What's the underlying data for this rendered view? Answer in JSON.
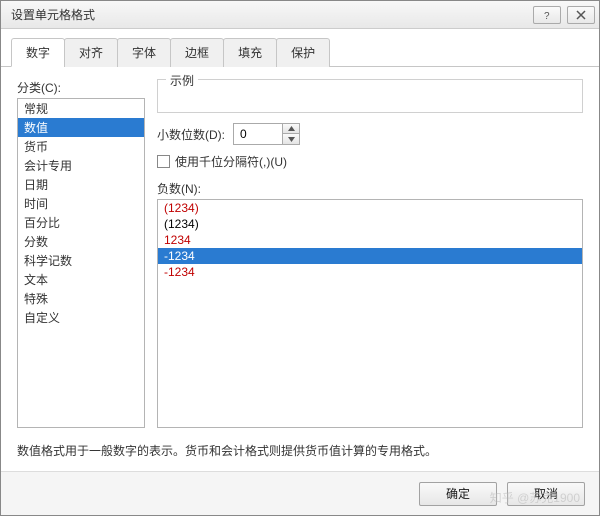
{
  "window": {
    "title": "设置单元格格式"
  },
  "tabs": [
    "数字",
    "对齐",
    "字体",
    "边框",
    "填充",
    "保护"
  ],
  "active_tab_index": 0,
  "category": {
    "label": "分类(C):",
    "items": [
      "常规",
      "数值",
      "货币",
      "会计专用",
      "日期",
      "时间",
      "百分比",
      "分数",
      "科学记数",
      "文本",
      "特殊",
      "自定义"
    ],
    "selected_index": 1
  },
  "sample": {
    "legend": "示例",
    "value": ""
  },
  "decimals": {
    "label": "小数位数(D):",
    "value": "0"
  },
  "thousands": {
    "label": "使用千位分隔符(,)(U)",
    "checked": false
  },
  "negative": {
    "label": "负数(N):",
    "items": [
      {
        "text": "(1234)",
        "color": "red"
      },
      {
        "text": "(1234)",
        "color": "black"
      },
      {
        "text": "1234",
        "color": "red"
      },
      {
        "text": "-1234",
        "color": "black"
      },
      {
        "text": "-1234",
        "color": "red"
      }
    ],
    "selected_index": 3
  },
  "description": "数值格式用于一般数字的表示。货币和会计格式则提供货币值计算的专用格式。",
  "footer": {
    "ok": "确定",
    "cancel": "取消"
  },
  "watermark": "知乎 @苏克1900"
}
